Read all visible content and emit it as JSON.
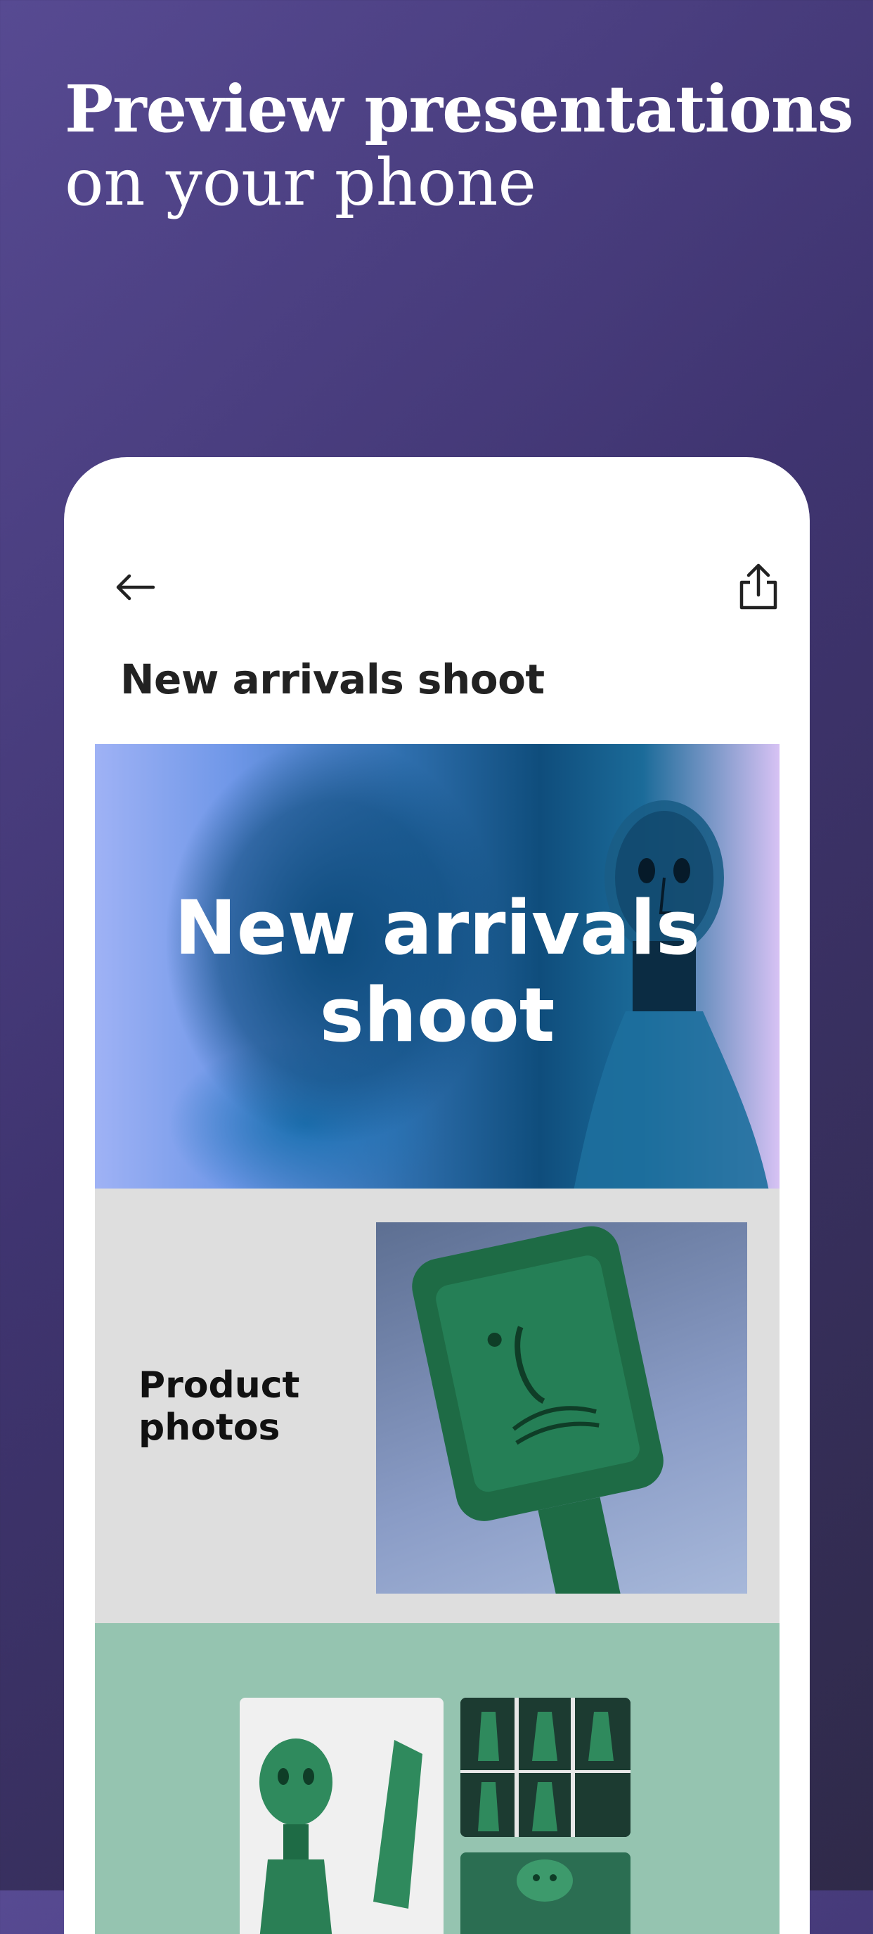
{
  "headline": {
    "line1": "Preview presentations",
    "line2": "on your phone"
  },
  "app": {
    "back_icon": "arrow-left-icon",
    "share_icon": "share-icon",
    "title": "New arrivals shoot"
  },
  "slides": [
    {
      "title": "New arrivals shoot",
      "image": "blue-glass-bottle-face"
    },
    {
      "label": "Product photos",
      "image": "green-glass-bottle-face"
    },
    {
      "image": "green-glass-bottles-grid"
    }
  ],
  "colors": {
    "background_start": "#574a92",
    "background_end": "#2f2a49",
    "slide2_bg": "#dedede",
    "slide3_bg": "#95c4b0"
  }
}
